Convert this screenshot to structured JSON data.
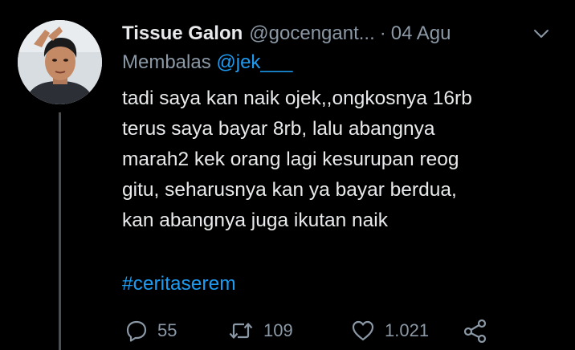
{
  "tweet": {
    "display_name": "Tissue Galon",
    "handle": "@gocengant...",
    "separator": "·",
    "date": "04 Agu",
    "replying_to_label": "Membalas",
    "replying_to_handle": "@jek___",
    "text_lines": [
      "tadi saya kan naik ojek,,ongkosnya 16rb",
      "terus saya bayar 8rb, lalu abangnya",
      "marah2 kek orang lagi kesurupan reog",
      "gitu, seharusnya kan ya bayar berdua,",
      "kan abangnya juga ikutan naik"
    ],
    "hashtag": "#ceritaserem"
  },
  "actions": {
    "reply_count": "55",
    "retweet_count": "109",
    "like_count": "1.021"
  },
  "icons": {
    "reply": "reply-icon",
    "retweet": "retweet-icon",
    "like": "heart-icon",
    "share": "share-icon",
    "menu": "chevron-down-icon"
  },
  "colors": {
    "background": "#000000",
    "text": "#e7e9ea",
    "muted": "#8b98a5",
    "accent": "#1d9bf0"
  }
}
